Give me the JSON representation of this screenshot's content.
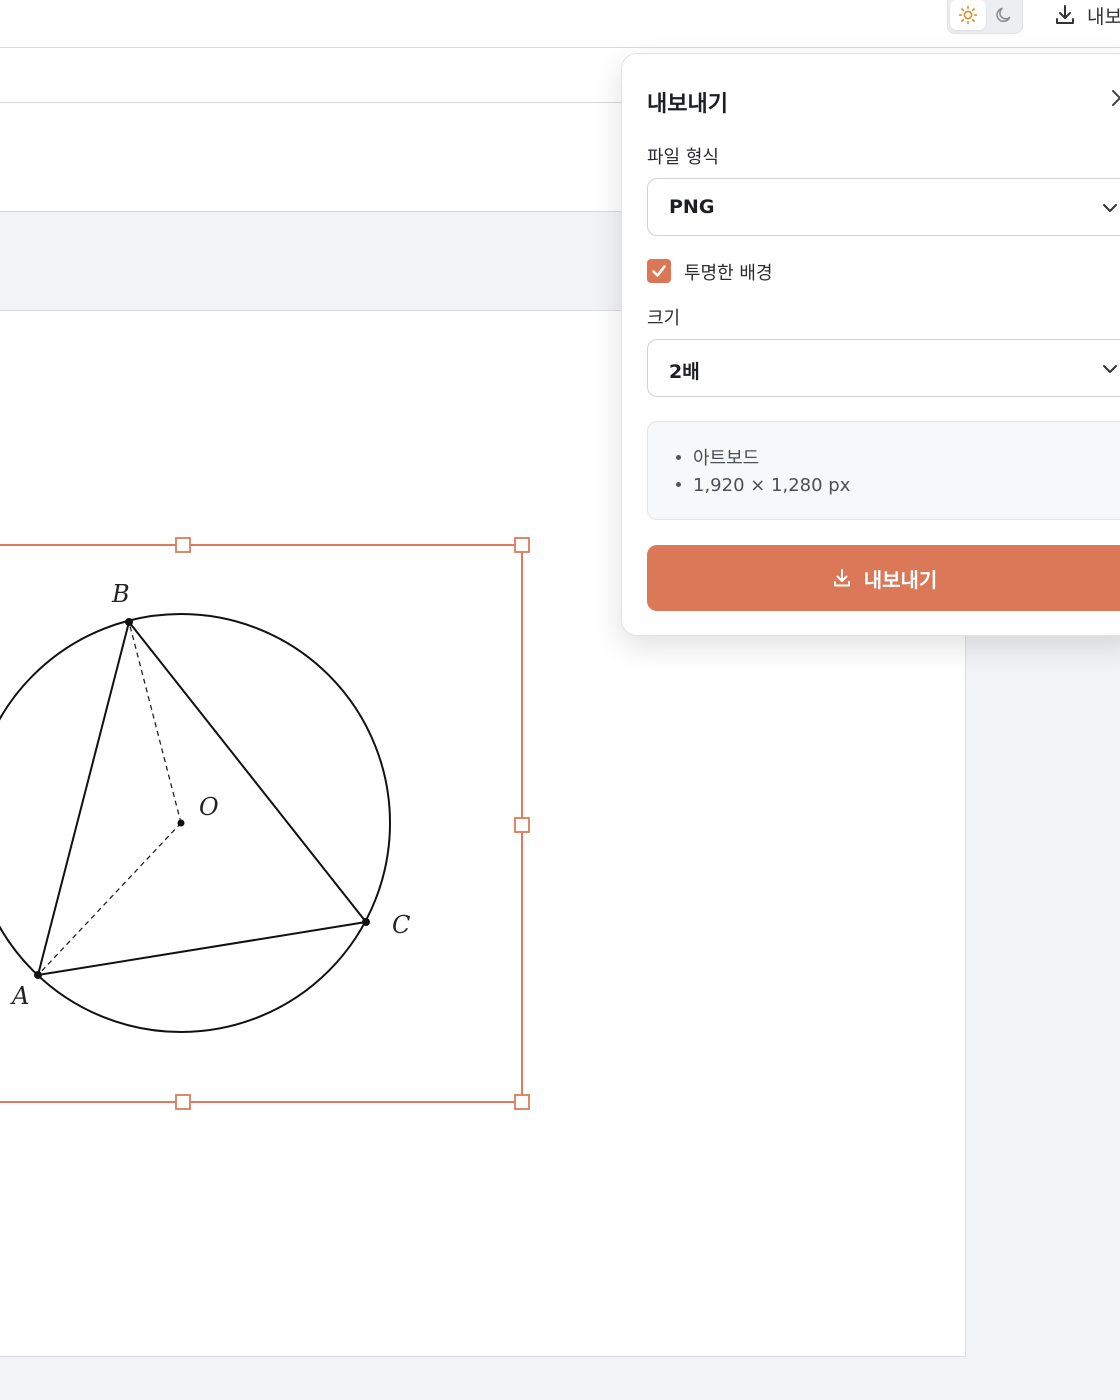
{
  "topbar": {
    "theme_light_icon": "sun-icon",
    "theme_dark_icon": "moon-icon",
    "export_icon": "download-icon",
    "export_label": "내보내기"
  },
  "figure": {
    "points": {
      "A": "A",
      "B": "B",
      "C": "C",
      "O": "O"
    },
    "selection_color": "#dd7b5a"
  },
  "export_popover": {
    "title": "내보내기",
    "close_icon": "close-icon",
    "format_label": "파일 형식",
    "format_value": "PNG",
    "transparent_label": "투명한 배경",
    "transparent_checked": true,
    "size_label": "크기",
    "size_value": "2배",
    "info": [
      "아트보드",
      "1,920 × 1,280 px"
    ],
    "export_button": "내보내기",
    "accent": "#da7857"
  }
}
